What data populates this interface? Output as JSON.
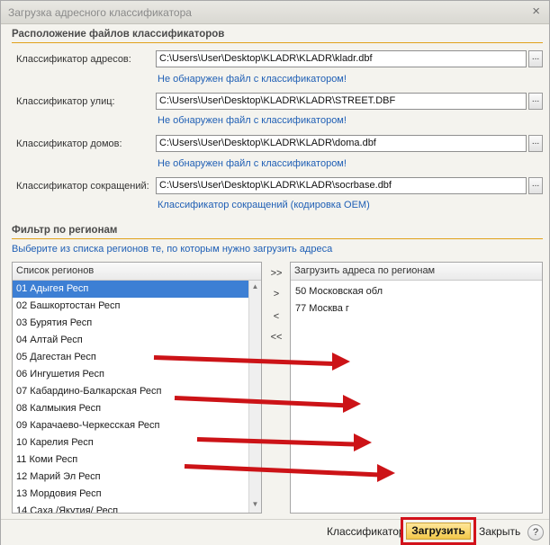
{
  "window": {
    "title": "Загрузка адресного классификатора",
    "close_glyph": "×"
  },
  "files_section": {
    "title": "Расположение файлов классификаторов",
    "rows": [
      {
        "label": "Классификатор адресов:",
        "path": "C:\\Users\\User\\Desktop\\KLADR\\KLADR\\kladr.dbf",
        "hint": "Не обнаружен файл с классификатором!"
      },
      {
        "label": "Классификатор улиц:",
        "path": "C:\\Users\\User\\Desktop\\KLADR\\KLADR\\STREET.DBF",
        "hint": "Не обнаружен файл с классификатором!"
      },
      {
        "label": "Классификатор домов:",
        "path": "C:\\Users\\User\\Desktop\\KLADR\\KLADR\\doma.dbf",
        "hint": "Не обнаружен файл с классификатором!"
      },
      {
        "label": "Классификатор сокращений:",
        "path": "C:\\Users\\User\\Desktop\\KLADR\\KLADR\\socrbase.dbf",
        "hint": "Классификатор сокращений (кодировка OEM)"
      }
    ],
    "browse_label": "..."
  },
  "filter_section": {
    "title": "Фильтр по регионам",
    "instruction": "Выберите из списка регионов те, по которым нужно загрузить адреса",
    "left_list": {
      "header": "Список регионов",
      "items": [
        "01 Адыгея Респ",
        "02 Башкортостан Респ",
        "03 Бурятия Респ",
        "04 Алтай Респ",
        "05 Дагестан Респ",
        "06 Ингушетия Респ",
        "07 Кабардино-Балкарская Респ",
        "08 Калмыкия Респ",
        "09 Карачаево-Черкесская Респ",
        "10 Карелия Респ",
        "11 Коми Респ",
        "12 Марий Эл Респ",
        "13 Мордовия Респ",
        "14 Саха /Якутия/ Респ"
      ],
      "selected_index": 0
    },
    "move_buttons": {
      "add_all": ">>",
      "add": ">",
      "remove": "<",
      "remove_all": "<<"
    },
    "right_list": {
      "header": "Загрузить адреса по регионам",
      "items": [
        "50 Московская обл",
        "77 Москва г"
      ]
    }
  },
  "footer": {
    "classifier_label": "Классификатор",
    "load_label": "Загрузить",
    "close_label": "Закрыть",
    "help_label": "?"
  },
  "colors": {
    "accent": "#e0a11b",
    "link": "#1f5fb5",
    "selection": "#3d7fd4",
    "highlight": "#d2121b"
  }
}
